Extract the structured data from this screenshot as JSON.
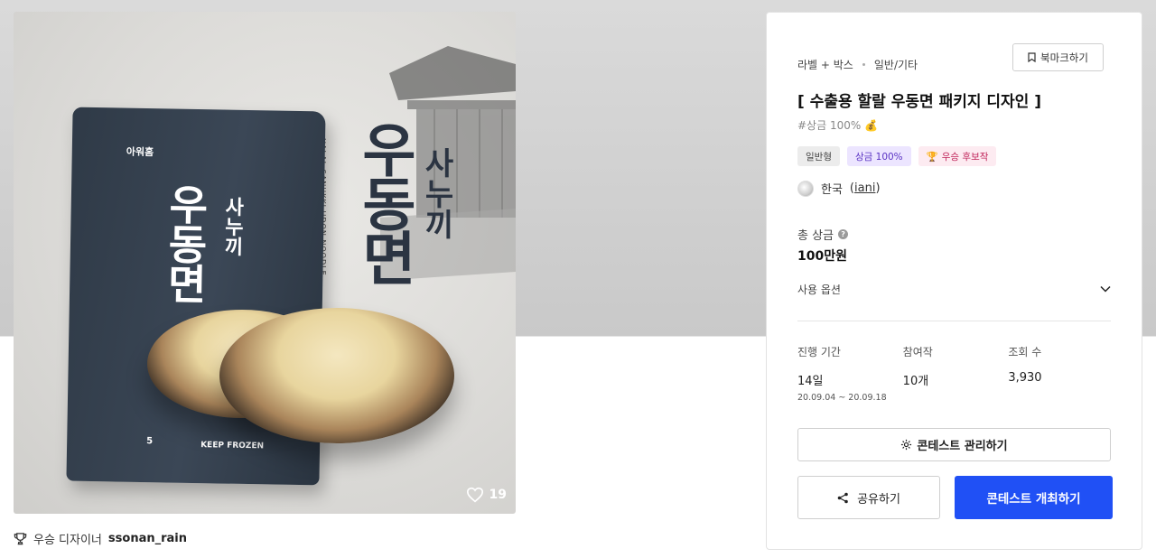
{
  "hero": {
    "brand": "아워홈",
    "pkg_title": "우동면",
    "pkg_sub": "사누끼",
    "pkg_foot_count": "5",
    "pkg_foot_frozen": "KEEP FROZEN",
    "big_title": "우동면",
    "big_sub": "사누끼",
    "big_en": "HALAL SANUKKI UDON NOODLE",
    "like_count": "19"
  },
  "winner": {
    "label": "우승 디자이너",
    "name": "ssonan_rain"
  },
  "panel": {
    "category": "라벨 + 박스",
    "subcategory": "일반/기타",
    "bookmark_label": "북마크하기",
    "title": "[ 수출용 할랄 우동면 패키지 디자인 ]",
    "hashtag": "#상금 100%",
    "tags": [
      {
        "label": "일반형",
        "style": "gray"
      },
      {
        "label": "상금 100%",
        "style": "purple"
      },
      {
        "label": "우승 후보작",
        "style": "pink"
      }
    ],
    "host_country": "한국",
    "host_handle": "iani",
    "prize_label": "총 상금",
    "prize_help": "?",
    "prize_value": "100만원",
    "usage_label": "사용 옵션",
    "stats": [
      {
        "label": "진행 기간",
        "value": "14일",
        "range": "20.09.04 ~ 20.09.18"
      },
      {
        "label": "참여작",
        "value": "10개"
      },
      {
        "label": "조회 수",
        "value": "3,930"
      }
    ],
    "manage_button": "콘테스트 관리하기",
    "share_button": "공유하기",
    "host_button": "콘테스트 개최하기"
  },
  "colors": {
    "primary": "#2050f5",
    "tag_purple_bg": "#ece5ff",
    "tag_pink_bg": "#fdebf1"
  }
}
